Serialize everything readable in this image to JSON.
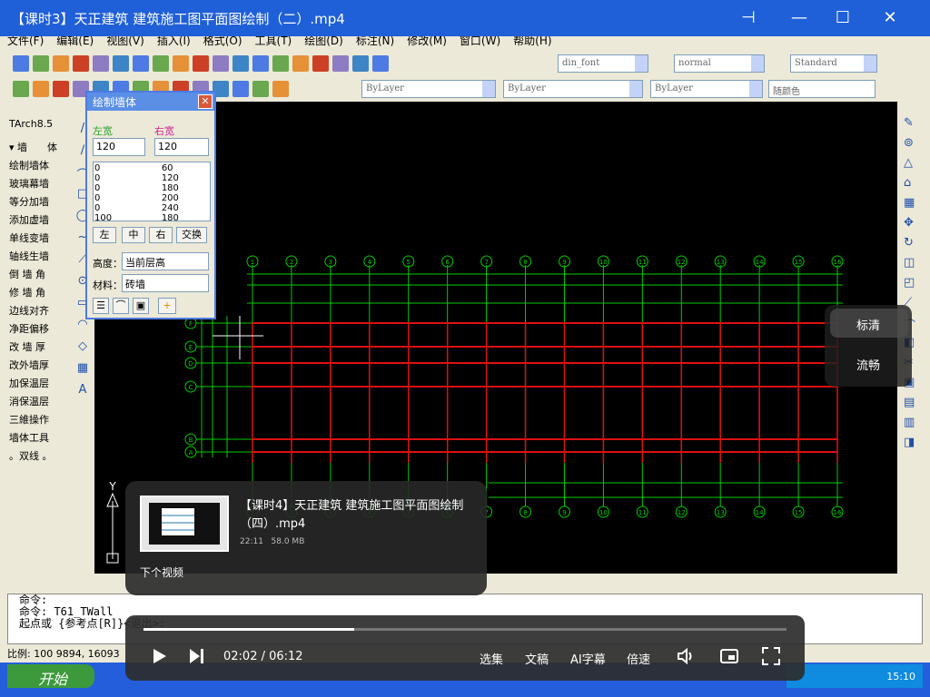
{
  "window": {
    "title": "【课时3】天正建筑 建筑施工图平面图绘制（二）.mp4",
    "controls": {
      "pin": "⊣",
      "minimize": "—",
      "maximize": "☐",
      "close": "✕"
    }
  },
  "app": {
    "menu": [
      "文件(F)",
      "编辑(E)",
      "视图(V)",
      "插入(I)",
      "格式(O)",
      "工具(T)",
      "绘图(D)",
      "标注(N)",
      "修改(M)",
      "窗口(W)",
      "帮助(H)"
    ],
    "combos": {
      "font": "din_font",
      "dimstyle": "normal",
      "textstyle": "Standard",
      "layer1": "ByLayer",
      "layer2": "ByLayer",
      "layer3": "ByLayer",
      "color": "随颜色"
    },
    "palette_title": "TArch8.5",
    "palette_items": [
      "▾ 墙　　体",
      "绘制墙体",
      "玻璃幕墙",
      "等分加墙",
      "添加虚墙",
      "单线变墙",
      "轴线生墙",
      "倒 墙 角",
      "修 墙 角",
      "边线对齐",
      "净距偏移",
      "改 墙 厚",
      "改外墙厚",
      "加保温层",
      "消保温层",
      "三維操作",
      "墙体工具",
      "。双线 。"
    ]
  },
  "dialog": {
    "title": "绘制墙体",
    "left_width_label": "左宽",
    "right_width_label": "右宽",
    "left_width": "120",
    "right_width": "120",
    "rows": [
      [
        "0",
        "60"
      ],
      [
        "0",
        "120"
      ],
      [
        "0",
        "180"
      ],
      [
        "0",
        "200"
      ],
      [
        "0",
        "240"
      ],
      [
        "100",
        "180"
      ]
    ],
    "align_buttons": [
      "左",
      "中",
      "右",
      "交换"
    ],
    "height_label": "高度：",
    "height_value": "当前层高",
    "material_label": "材料：",
    "material_value": "砖墙"
  },
  "drawing": {
    "top_axis_labels": [
      "1",
      "2",
      "3",
      "4",
      "5",
      "6",
      "7",
      "8",
      "9",
      "10",
      "11",
      "12",
      "13",
      "14",
      "15",
      "16"
    ],
    "left_axis_labels": [
      "F",
      "E",
      "D",
      "C",
      "B",
      "A"
    ],
    "ucs_y_label": "Y",
    "background": "#000000",
    "grid_color": "#00cc00",
    "wall_color": "#dd1111"
  },
  "command": {
    "lines": [
      "命令:",
      "命令: T61_TWall",
      "起点或 {参考点[R]}<退出>:"
    ],
    "status": "比例: 100  9894,  16093"
  },
  "taskbar": {
    "start": "开始",
    "clock": "15:10"
  },
  "quality_menu": {
    "options": [
      "标清",
      "流畅"
    ],
    "selected": "标清"
  },
  "next_video": {
    "title": "【课时4】天正建筑 建筑施工图平面图绘制（四）.mp4",
    "duration": "22:11",
    "size": "58.0 MB",
    "label": "下个视频"
  },
  "player": {
    "current_time": "02:02",
    "total_time": "06:12",
    "time_display": "02:02 / 06:12",
    "progress_fraction": 0.328,
    "buttons": {
      "episodes": "选集",
      "transcript": "文稿",
      "ai_subtitle": "AI字幕",
      "speed": "倍速"
    }
  }
}
